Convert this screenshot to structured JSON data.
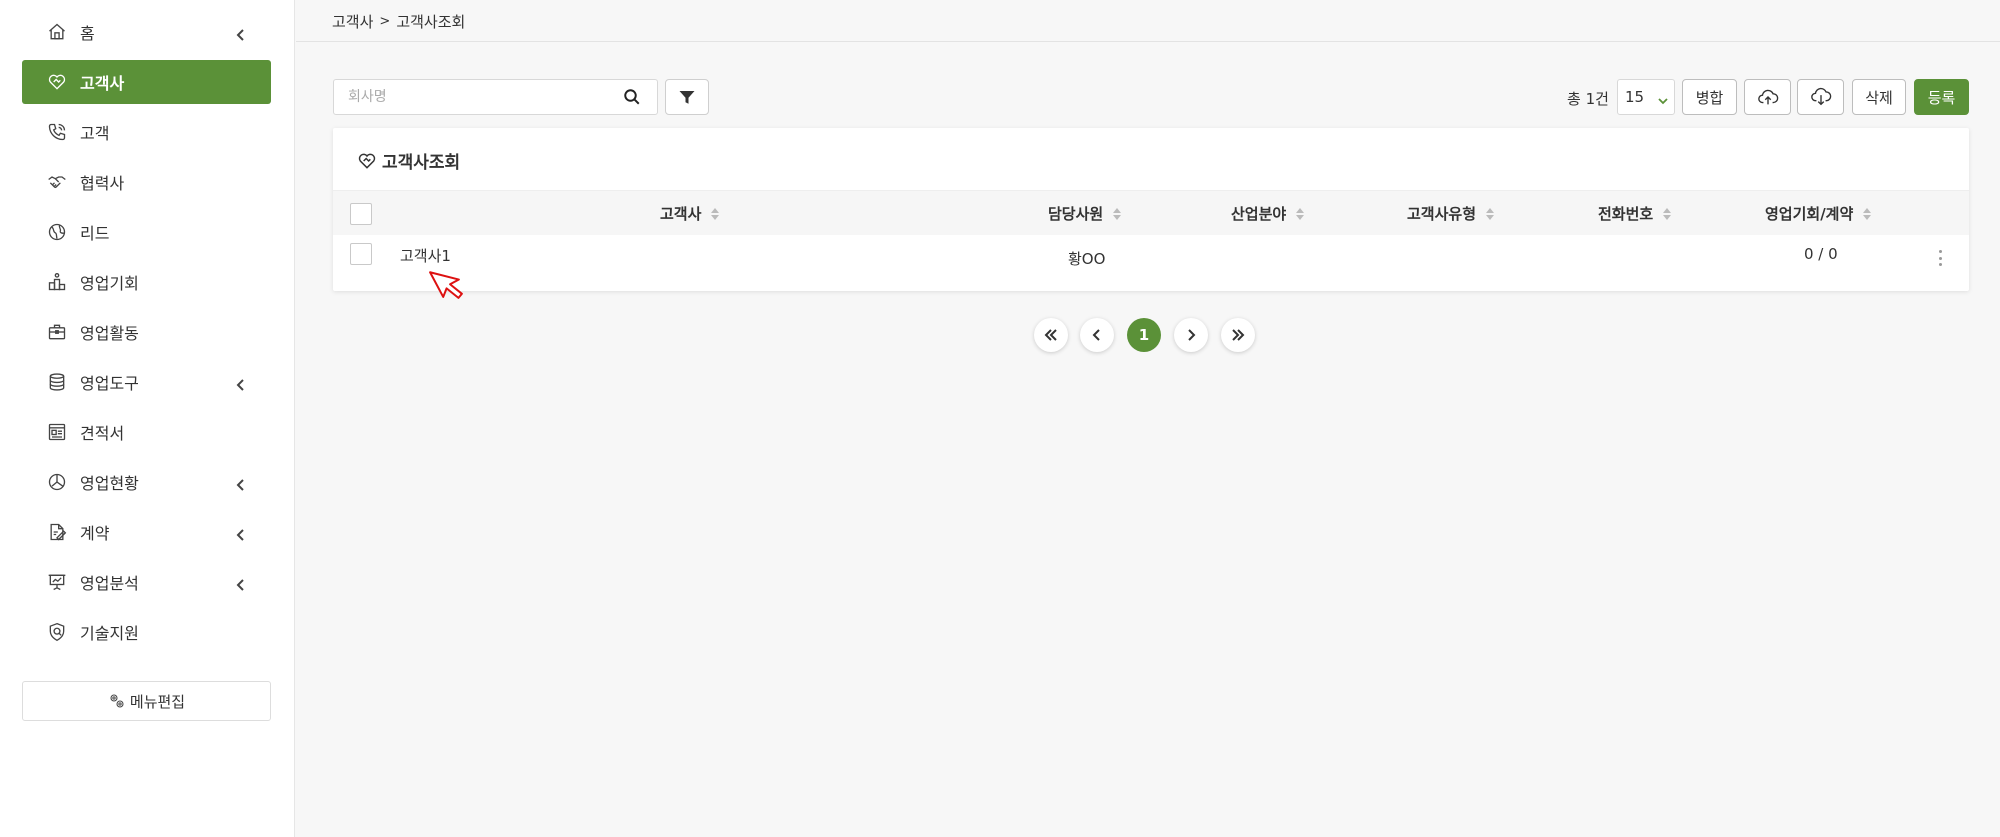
{
  "sidebar": {
    "items": [
      {
        "label": "홈",
        "icon": "home-icon",
        "has_submenu": true,
        "active": false
      },
      {
        "label": "고객사",
        "icon": "heart-handshake-icon",
        "has_submenu": false,
        "active": true
      },
      {
        "label": "고객",
        "icon": "phone-icon",
        "has_submenu": false,
        "active": false
      },
      {
        "label": "협력사",
        "icon": "handshake-icon",
        "has_submenu": false,
        "active": false
      },
      {
        "label": "리드",
        "icon": "globe-icon",
        "has_submenu": false,
        "active": false
      },
      {
        "label": "영업기회",
        "icon": "podium-icon",
        "has_submenu": false,
        "active": false
      },
      {
        "label": "영업활동",
        "icon": "briefcase-icon",
        "has_submenu": false,
        "active": false
      },
      {
        "label": "영업도구",
        "icon": "database-icon",
        "has_submenu": true,
        "active": false
      },
      {
        "label": "견적서",
        "icon": "estimate-icon",
        "has_submenu": false,
        "active": false
      },
      {
        "label": "영업현황",
        "icon": "pie-chart-icon",
        "has_submenu": true,
        "active": false
      },
      {
        "label": "계약",
        "icon": "contract-icon",
        "has_submenu": true,
        "active": false
      },
      {
        "label": "영업분석",
        "icon": "presentation-icon",
        "has_submenu": true,
        "active": false
      },
      {
        "label": "기술지원",
        "icon": "support-icon",
        "has_submenu": false,
        "active": false
      }
    ],
    "edit_label": "메뉴편집"
  },
  "breadcrumb": {
    "parent": "고객사",
    "separator": ">",
    "current": "고객사조회"
  },
  "toolbar": {
    "search_placeholder": "회사명",
    "total_label": "총 1건",
    "page_size": "15",
    "merge_label": "병합",
    "delete_label": "삭제",
    "register_label": "등록"
  },
  "card": {
    "title": "고객사조회",
    "columns": [
      "고객사",
      "담당사원",
      "산업분야",
      "고객사유형",
      "전화번호",
      "영업기회/계약"
    ],
    "rows": [
      {
        "company": "고객사1",
        "manager": "황OO",
        "industry": "",
        "type": "",
        "phone": "",
        "opportunity": "0 / 0"
      }
    ]
  },
  "pagination": {
    "current": "1"
  },
  "colors": {
    "accent": "#5b9138"
  }
}
